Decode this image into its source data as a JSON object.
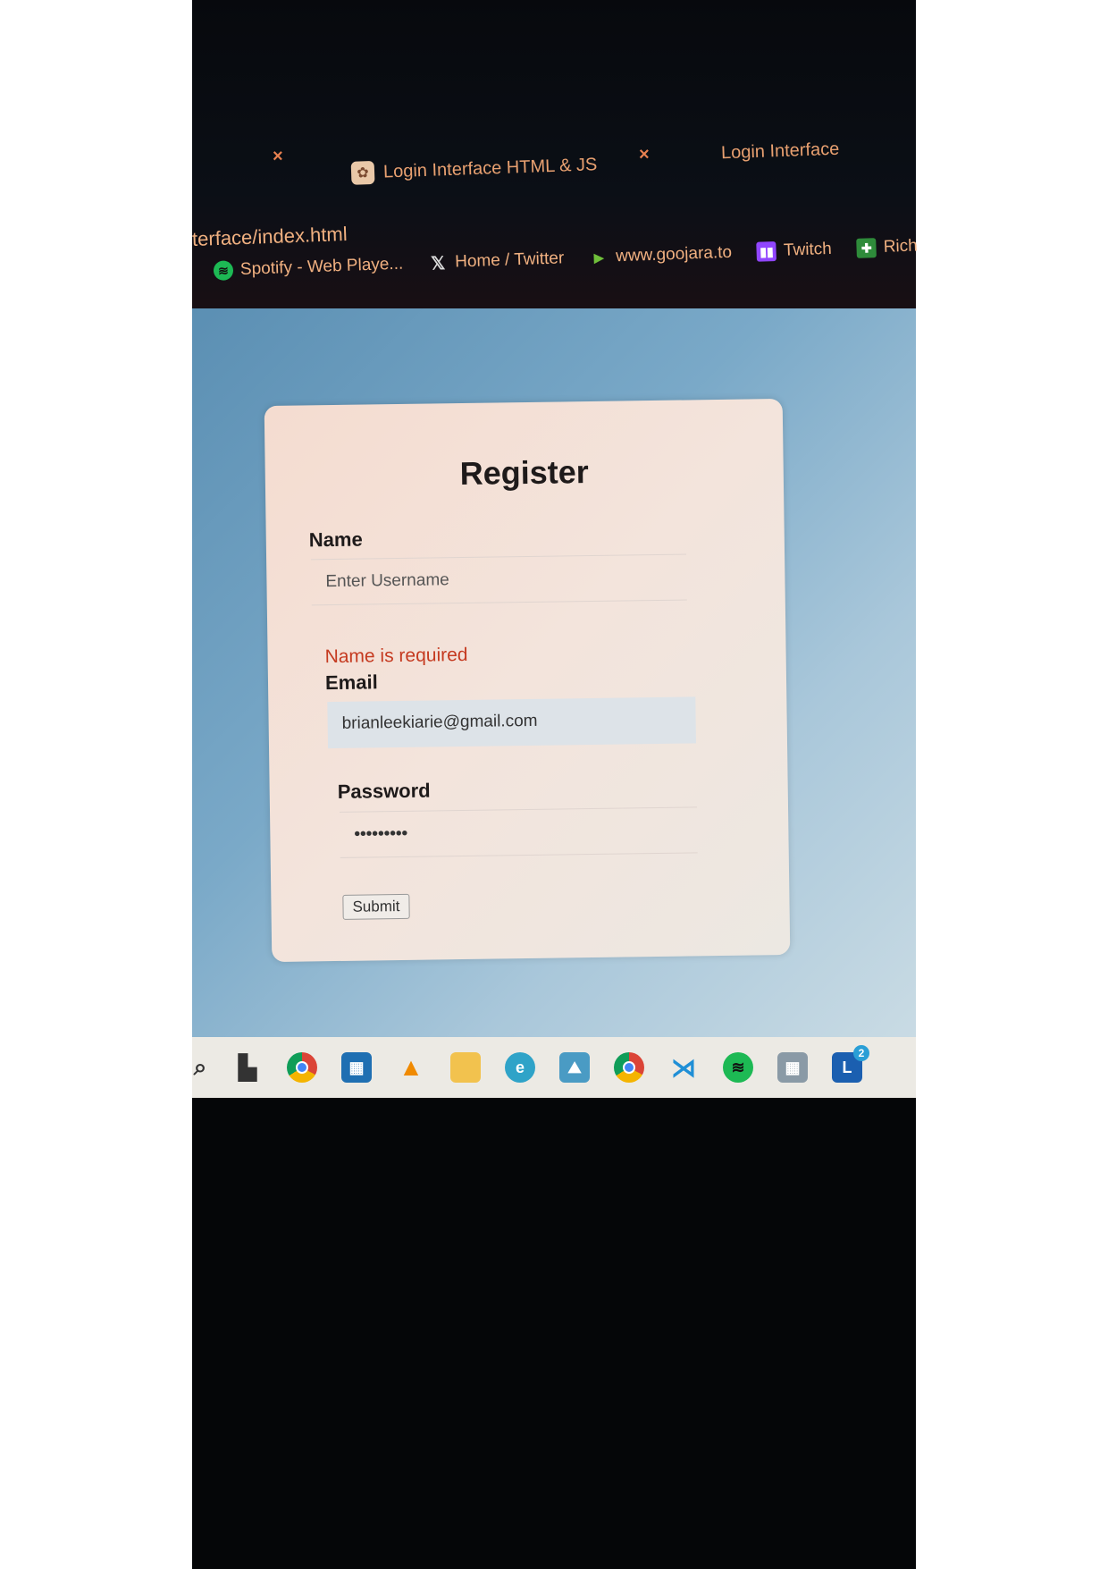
{
  "browser": {
    "tabs": [
      {
        "label": "Login Interface HTML & JS",
        "icon": "chatgpt-icon"
      },
      {
        "label": "Login Interface"
      }
    ],
    "url": "terface/index.html",
    "bookmarks": [
      {
        "label": "Spotify - Web Playe...",
        "icon": "spotify-icon",
        "color": "#1db954"
      },
      {
        "label": "Home / Twitter",
        "icon": "x-icon",
        "color": "#dddddd"
      },
      {
        "label": "www.goojara.to",
        "icon": "play-icon",
        "color": "#6fbf3a"
      },
      {
        "label": "Twitch",
        "icon": "twitch-icon",
        "color": "#9146ff"
      },
      {
        "label": "Rich",
        "icon": "plus-icon",
        "color": "#2e8b3a"
      }
    ]
  },
  "form": {
    "title": "Register",
    "name_label": "Name",
    "name_placeholder": "Enter Username",
    "name_error": "Name is required",
    "email_label": "Email",
    "email_value": "brianleekiarie@gmail.com",
    "password_label": "Password",
    "password_value": "•••••••••",
    "submit_label": "Submit"
  },
  "taskbar": {
    "icons": [
      "search-icon",
      "task-view-icon",
      "chrome-icon",
      "store-icon",
      "vlc-icon",
      "file-explorer-icon",
      "edge-icon",
      "photos-icon",
      "chrome-icon",
      "vscode-icon",
      "spotify-icon",
      "calculator-icon",
      "app-l-icon"
    ],
    "badge": "2"
  }
}
